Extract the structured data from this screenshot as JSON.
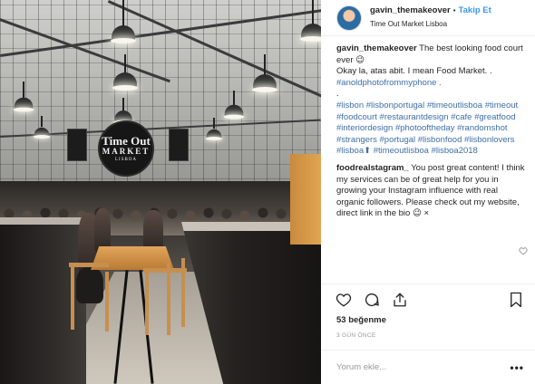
{
  "post": {
    "username": "gavin_themakeover",
    "follow_label": "Takip Et",
    "dot": "•",
    "location": "Time Out Market Lisboa",
    "photo_sign": {
      "line1": "Time Out",
      "line2": "MARKET",
      "line3": "LISBOA"
    }
  },
  "comments": [
    {
      "user": "gavin_themakeover",
      "lines": [
        " The best looking food court ever 😉",
        "Okay la, atas abit. I mean Food Market. .",
        "#anoldphotofrommyphone .",
        ".",
        "#lisbon #lisbonportugal #timeoutlisboa #timeout #foodcourt #restaurantdesign #cafe #greatfood #interiordesign #photooftheday #randomshot #strangers #portugal #lisbonfood #lisbonlovers #lisboa⬆ #timeoutlisboa #lisboa2018"
      ]
    },
    {
      "user": "foodrealstagram_",
      "text": " You post great content! I think my services can be of great help for you in growing your Instagram influence with real organic followers. Please check out my website, direct link in the bio 😉 ×"
    }
  ],
  "actions": {
    "like_icon": "heart-icon",
    "comment_icon": "comment-bubble-icon",
    "share_icon": "share-icon",
    "save_icon": "bookmark-icon"
  },
  "likes_label": "53 beğenme",
  "time_label": "3 GÜN ÖNCE",
  "comment_placeholder": "Yorum ekle...",
  "more_label": "•••",
  "colors": {
    "link": "#3897f0",
    "hashtag": "#3e6fa8",
    "muted": "#999999",
    "text": "#262626"
  }
}
